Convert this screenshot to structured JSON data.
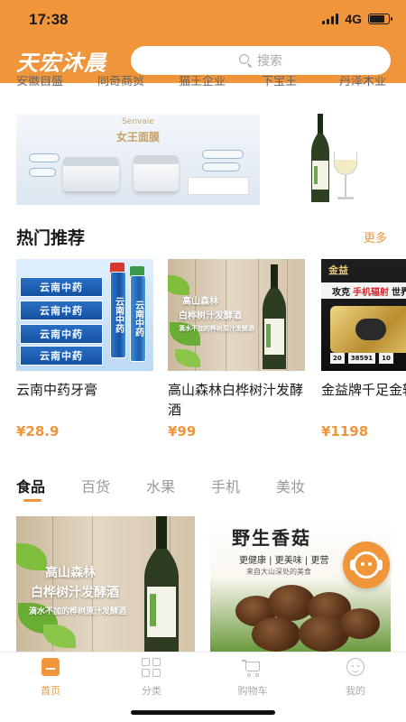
{
  "status_bar": {
    "time": "17:38",
    "network": "4G",
    "battery_level": 0.85
  },
  "header": {
    "logo": "天宏沐晨",
    "search_placeholder": "搜索"
  },
  "category_row": [
    "安徽自盛",
    "同奇商贸",
    "猫王企业",
    "下宝王",
    "丹泽木业"
  ],
  "banner": {
    "brand": "Senvaie",
    "title": "女王面膜"
  },
  "hot": {
    "title": "热门推荐",
    "more": "更多",
    "products": [
      {
        "name": "云南中药牙膏",
        "price": "¥28.9",
        "image_label": "云南中药"
      },
      {
        "name": "高山森林白桦树汁发酵酒",
        "price": "¥99",
        "image_label_1": "高山森林",
        "image_label_2": "白桦树汁发酵酒",
        "image_label_3": "滴水不加的桦树原汁发酵酒"
      },
      {
        "name": "金益牌千足金辐射产品",
        "price": "¥1198",
        "image_label_1": "金益",
        "image_label_2": "攻克",
        "image_label_3": "手机辐射",
        "image_label_4": "世界难题"
      }
    ]
  },
  "tabs": [
    "食品",
    "百货",
    "水果",
    "手机",
    "美妆"
  ],
  "feed": {
    "wine_text_1": "高山森林",
    "wine_text_2": "白桦树汁发酵酒",
    "wine_text_3": "滴水不加的桦树原汁发酵酒",
    "mushroom_title": "野生香菇",
    "mushroom_line2": "更健康 | 更美味 | 更营",
    "mushroom_line3": "来自大山深处的美食"
  },
  "tabbar": [
    {
      "label": "首页",
      "icon": "home-icon",
      "active": true
    },
    {
      "label": "分类",
      "icon": "grid-icon",
      "active": false
    },
    {
      "label": "购物车",
      "icon": "cart-icon",
      "active": false
    },
    {
      "label": "我的",
      "icon": "profile-icon",
      "active": false
    }
  ],
  "colors": {
    "accent": "#f0953a",
    "text": "#1a1a1a",
    "muted": "#999999"
  }
}
